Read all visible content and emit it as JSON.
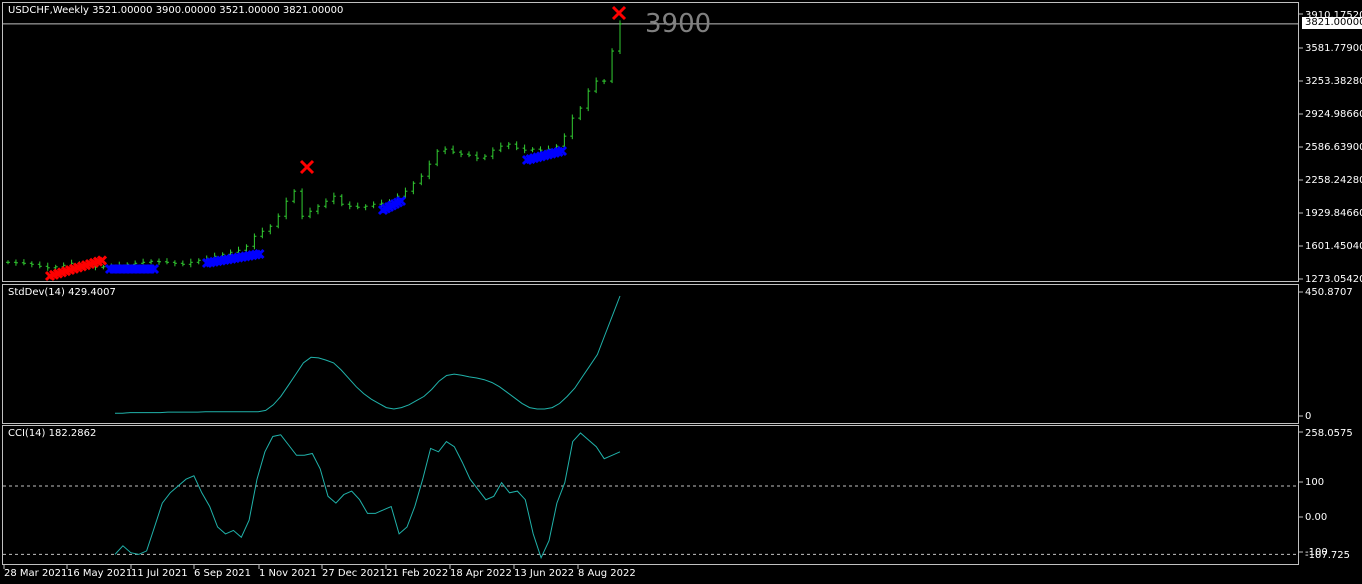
{
  "main": {
    "header": "USDCHF,Weekly  3521.00000 3900.00000 3521.00000 3821.00000",
    "price_axis": [
      "3910.17520",
      "3581.77900",
      "3253.38280",
      "2924.98660",
      "2586.63900",
      "2258.24280",
      "1929.84660",
      "1601.45040",
      "1273.05420"
    ],
    "current_price": "3821.00000",
    "annotation": "3900"
  },
  "stddev": {
    "header": "StdDev(14) 429.4007",
    "axis": [
      "450.8707",
      "0"
    ]
  },
  "cci": {
    "header": "CCI(14) 182.2862",
    "axis": [
      "258.0575",
      "100",
      "0.00",
      "-100",
      "-107.725"
    ]
  },
  "time_axis": [
    "28 Mar 2021",
    "16 May 2021",
    "11 Jul 2021",
    "6 Sep 2021",
    "1 Nov 2021",
    "27 Dec 2021",
    "21 Feb 2022",
    "18 Apr 2022",
    "13 Jun 2022",
    "8 Aug 2022"
  ],
  "colors": {
    "bars": "#32cd32",
    "indicator": "#20b2aa",
    "sell_marker": "#ff0000",
    "buy_marker": "#0000ff"
  },
  "chart_data": [
    {
      "type": "line",
      "title": "USDCHF,Weekly",
      "series": [
        {
          "name": "USDCHF",
          "values": [
            1440,
            1435,
            1430,
            1420,
            1400,
            1385,
            1395,
            1410,
            1430,
            1420,
            1400,
            1390,
            1395,
            1400,
            1410,
            1420,
            1430,
            1440,
            1450,
            1445,
            1440,
            1430,
            1420,
            1440,
            1460,
            1480,
            1500,
            1520,
            1540,
            1560,
            1600,
            1700,
            1750,
            1800,
            1900,
            2050,
            2150,
            1900,
            1950,
            2000,
            2050,
            2100,
            2020,
            2000,
            1990,
            2000,
            2020,
            2030,
            2050,
            2100,
            2150,
            2230,
            2300,
            2420,
            2550,
            2570,
            2540,
            2520,
            2510,
            2480,
            2500,
            2560,
            2600,
            2620,
            2580,
            2560,
            2570,
            2560,
            2570,
            2600,
            2700,
            2880,
            2980,
            3150,
            3250,
            3250,
            3550,
            3821
          ]
        }
      ],
      "ylim": [
        1273.05,
        3910.18
      ],
      "markers": {
        "sell": [
          2380,
          3900
        ],
        "buy": "clusters"
      }
    },
    {
      "type": "line",
      "title": "StdDev(14) 429.4007",
      "series": [
        {
          "name": "StdDev(14)",
          "values": [
            10,
            10,
            12,
            12,
            12,
            12,
            12,
            14,
            14,
            14,
            14,
            14,
            15,
            15,
            15,
            15,
            15,
            15,
            15,
            15,
            20,
            40,
            70,
            110,
            150,
            190,
            210,
            208,
            200,
            190,
            165,
            135,
            105,
            80,
            60,
            45,
            30,
            25,
            30,
            40,
            55,
            70,
            95,
            125,
            145,
            150,
            146,
            140,
            136,
            130,
            120,
            105,
            85,
            65,
            45,
            30,
            25,
            25,
            30,
            45,
            70,
            100,
            140,
            180,
            220,
            290,
            360,
            429.4
          ]
        }
      ],
      "ylim": [
        0,
        450.87
      ]
    },
    {
      "type": "line",
      "title": "CCI(14) 182.2862",
      "series": [
        {
          "name": "CCI(14)",
          "values": [
            -100,
            -75,
            -95,
            -100,
            -90,
            -20,
            50,
            80,
            100,
            120,
            130,
            80,
            40,
            -20,
            -40,
            -30,
            -50,
            0,
            120,
            200,
            245,
            250,
            220,
            190,
            190,
            195,
            150,
            70,
            50,
            75,
            85,
            60,
            20,
            20,
            30,
            40,
            -40,
            -20,
            40,
            120,
            210,
            200,
            230,
            215,
            170,
            120,
            90,
            60,
            70,
            110,
            80,
            85,
            60,
            -40,
            -110,
            -60,
            50,
            110,
            230,
            255,
            235,
            215,
            180,
            190,
            200
          ]
        }
      ],
      "ylim": [
        -107.725,
        258.06
      ],
      "levels": [
        100,
        -100
      ]
    }
  ]
}
